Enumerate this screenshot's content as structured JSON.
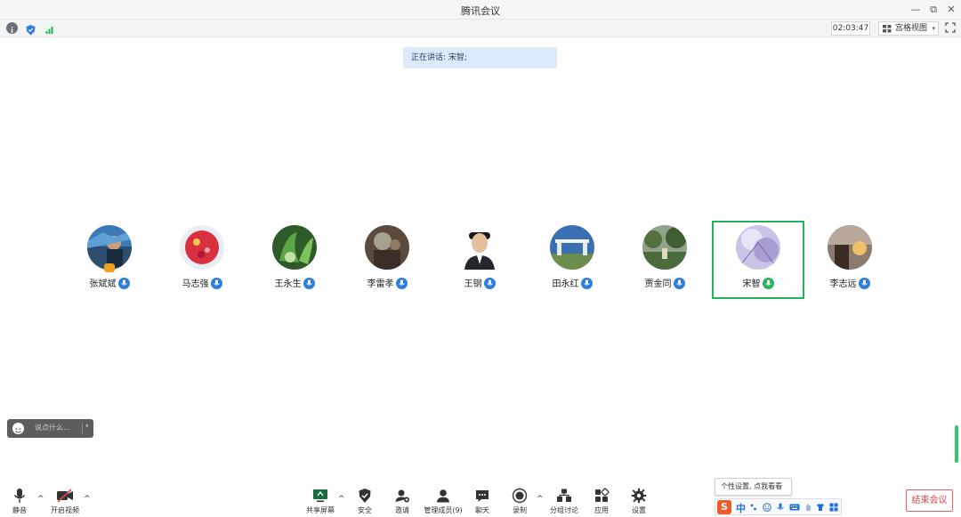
{
  "window": {
    "title": "腾讯会议",
    "minimize_glyph": "—",
    "restore_glyph": "⧉",
    "close_glyph": "✕"
  },
  "topbar": {
    "elapsed_time": "02:03:47",
    "view_mode_label": "宫格视图",
    "view_caret": "▾"
  },
  "speaking_banner": "正在讲话: 宋智;",
  "participants": [
    {
      "name": "张斌斌",
      "host": true
    },
    {
      "name": "马志强"
    },
    {
      "name": "王永生"
    },
    {
      "name": "李雷孝"
    },
    {
      "name": "王钢"
    },
    {
      "name": "田永红"
    },
    {
      "name": "贾金同"
    },
    {
      "name": "宋智",
      "active": true
    },
    {
      "name": "李志远"
    }
  ],
  "chat": {
    "placeholder": "说点什么...",
    "collapse_glyph": "‹"
  },
  "toolbar": {
    "mute": "静音",
    "video": "开启视频",
    "share_screen": "共享屏幕",
    "security": "安全",
    "invite": "邀请",
    "manage_members": "管理成员(9)",
    "chat": "聊天",
    "record": "录制",
    "breakout": "分组讨论",
    "apps": "应用",
    "settings": "设置",
    "end_meeting": "结束会议",
    "caret_up": "^"
  },
  "tooltip": "个性设置, 点我看看",
  "ime": {
    "logo": "S",
    "mode": "中"
  },
  "colors": {
    "accent_green": "#25b25d",
    "mic_blue": "#2f7de1",
    "end_red": "#e04646",
    "banner_blue": "#dbe9fb"
  }
}
